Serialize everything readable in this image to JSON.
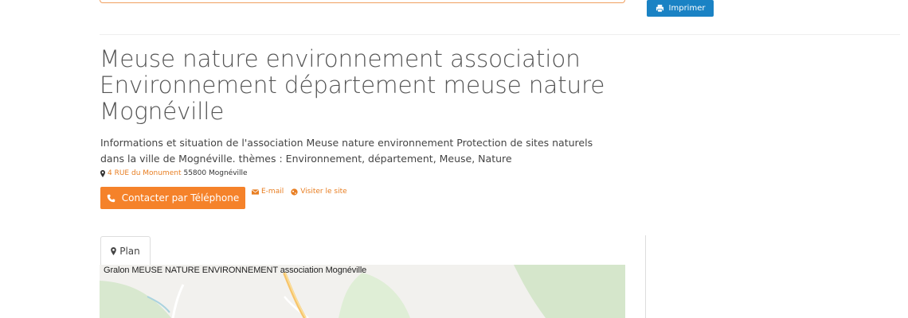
{
  "toolbar": {
    "print_label": "Imprimer"
  },
  "listing": {
    "title_lines": [
      "Meuse nature environnement association",
      "Environnement département meuse nature",
      "Mognéville"
    ],
    "description": "Informations et situation de l'association Meuse nature environnement Protection de sites naturels dans la ville de Mognéville. thèmes : Environnement, département, Meuse, Nature",
    "address": {
      "street": "4 RUE du Monument",
      "city": "55800 Mognéville"
    },
    "contact_label": "Contacter par Téléphone",
    "email_label": "E-mail",
    "website_label": "Visiter le site"
  },
  "map_section": {
    "tab_label": "Plan",
    "map_caption": "Gralon MEUSE NATURE ENVIRONNEMENT association Mognéville"
  },
  "colors": {
    "accent": "#f5822a",
    "link": "#e87e22",
    "print": "#1a82c4"
  },
  "icons": [
    "print-icon",
    "map-marker-icon",
    "phone-icon",
    "envelope-icon",
    "globe-icon"
  ]
}
